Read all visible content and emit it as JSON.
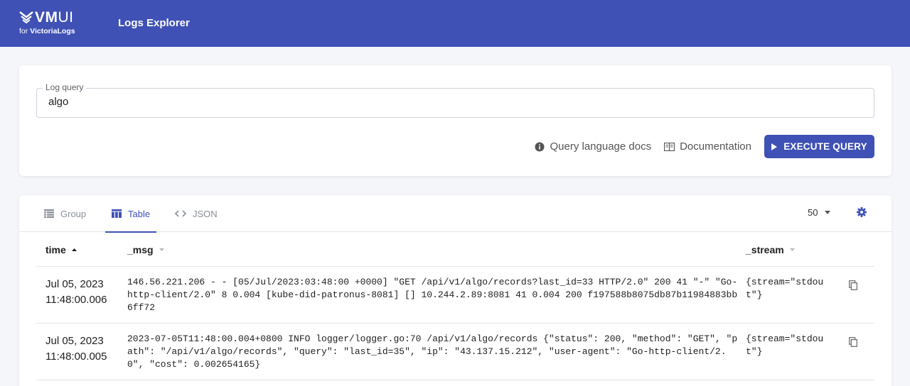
{
  "header": {
    "logo_main": "VM",
    "logo_ui": "UI",
    "logo_sub_prefix": "for ",
    "logo_sub_brand": "VictoriaLogs",
    "nav_label": "Logs Explorer"
  },
  "query": {
    "label": "Log query",
    "value": "algo",
    "docs_link": "Query language docs",
    "documentation_link": "Documentation",
    "execute_label": "EXECUTE QUERY"
  },
  "results": {
    "tabs": [
      {
        "label": "Group",
        "icon": "list-icon",
        "active": false
      },
      {
        "label": "Table",
        "icon": "table-icon",
        "active": true
      },
      {
        "label": "JSON",
        "icon": "code-icon",
        "active": false
      }
    ],
    "limit": "50",
    "columns": [
      {
        "label": "time",
        "sort": "asc"
      },
      {
        "label": "_msg",
        "sort": "none"
      },
      {
        "label": "_stream",
        "sort": "none"
      }
    ],
    "rows": [
      {
        "date": "Jul 05, 2023",
        "time": "11:48:00.006",
        "msg": "146.56.221.206 - - [05/Jul/2023:03:48:00 +0000] \"GET /api/v1/algo/records?last_id=33 HTTP/2.0\" 200 41 \"-\" \"Go-http-client/2.0\" 8 0.004 [kube-did-patronus-8081] [] 10.244.2.89:8081 41 0.004 200 f197588b8075db87b11984883bb6ff72",
        "stream": "{stream=\"stdout\"}"
      },
      {
        "date": "Jul 05, 2023",
        "time": "11:48:00.005",
        "msg": "2023-07-05T11:48:00.004+0800 INFO logger/logger.go:70 /api/v1/algo/records {\"status\": 200, \"method\": \"GET\", \"path\": \"/api/v1/algo/records\", \"query\": \"last_id=35\", \"ip\": \"43.137.15.212\", \"user-agent\": \"Go-http-client/2.0\", \"cost\": 0.002654165}",
        "stream": "{stream=\"stdout\"}"
      }
    ]
  },
  "colors": {
    "primary": "#3f51b5",
    "background": "#f5f6fa",
    "muted": "#8a8f99"
  }
}
